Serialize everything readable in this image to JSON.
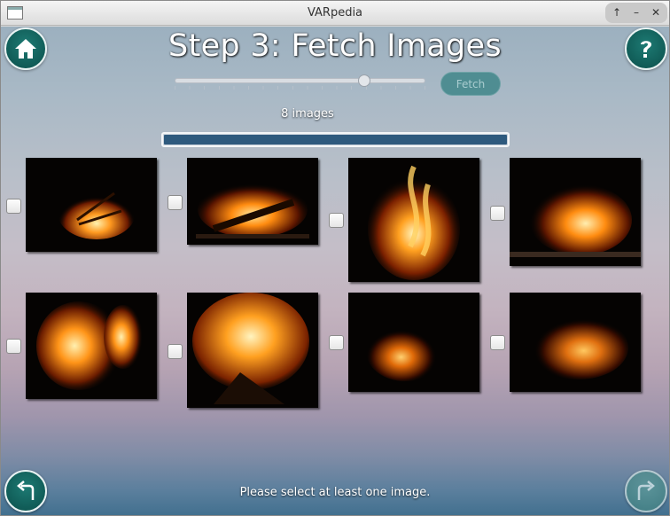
{
  "window": {
    "title": "VARpedia",
    "controls": [
      "↑",
      "–",
      "✕"
    ]
  },
  "header": {
    "step_title": "Step 3: Fetch Images"
  },
  "fetch": {
    "slider_value": 0.77,
    "button_label": "Fetch"
  },
  "results": {
    "count_label": "8 images",
    "progress": 1.0
  },
  "images": [
    {
      "name": "fire-image-1",
      "checked": false
    },
    {
      "name": "fire-image-2",
      "checked": false
    },
    {
      "name": "fire-image-3",
      "checked": false
    },
    {
      "name": "fire-image-4",
      "checked": false
    },
    {
      "name": "fire-image-5",
      "checked": false
    },
    {
      "name": "fire-image-6",
      "checked": false
    },
    {
      "name": "fire-image-7",
      "checked": false
    },
    {
      "name": "fire-image-8",
      "checked": false
    }
  ],
  "footer": {
    "status_text": "Please select at least one image."
  },
  "icons": {
    "home": "home-icon",
    "help": "help-icon",
    "back": "back-arrow-icon",
    "next": "forward-arrow-icon"
  },
  "colors": {
    "accent": "#0b5a55",
    "progress": "#2e5a7e"
  }
}
